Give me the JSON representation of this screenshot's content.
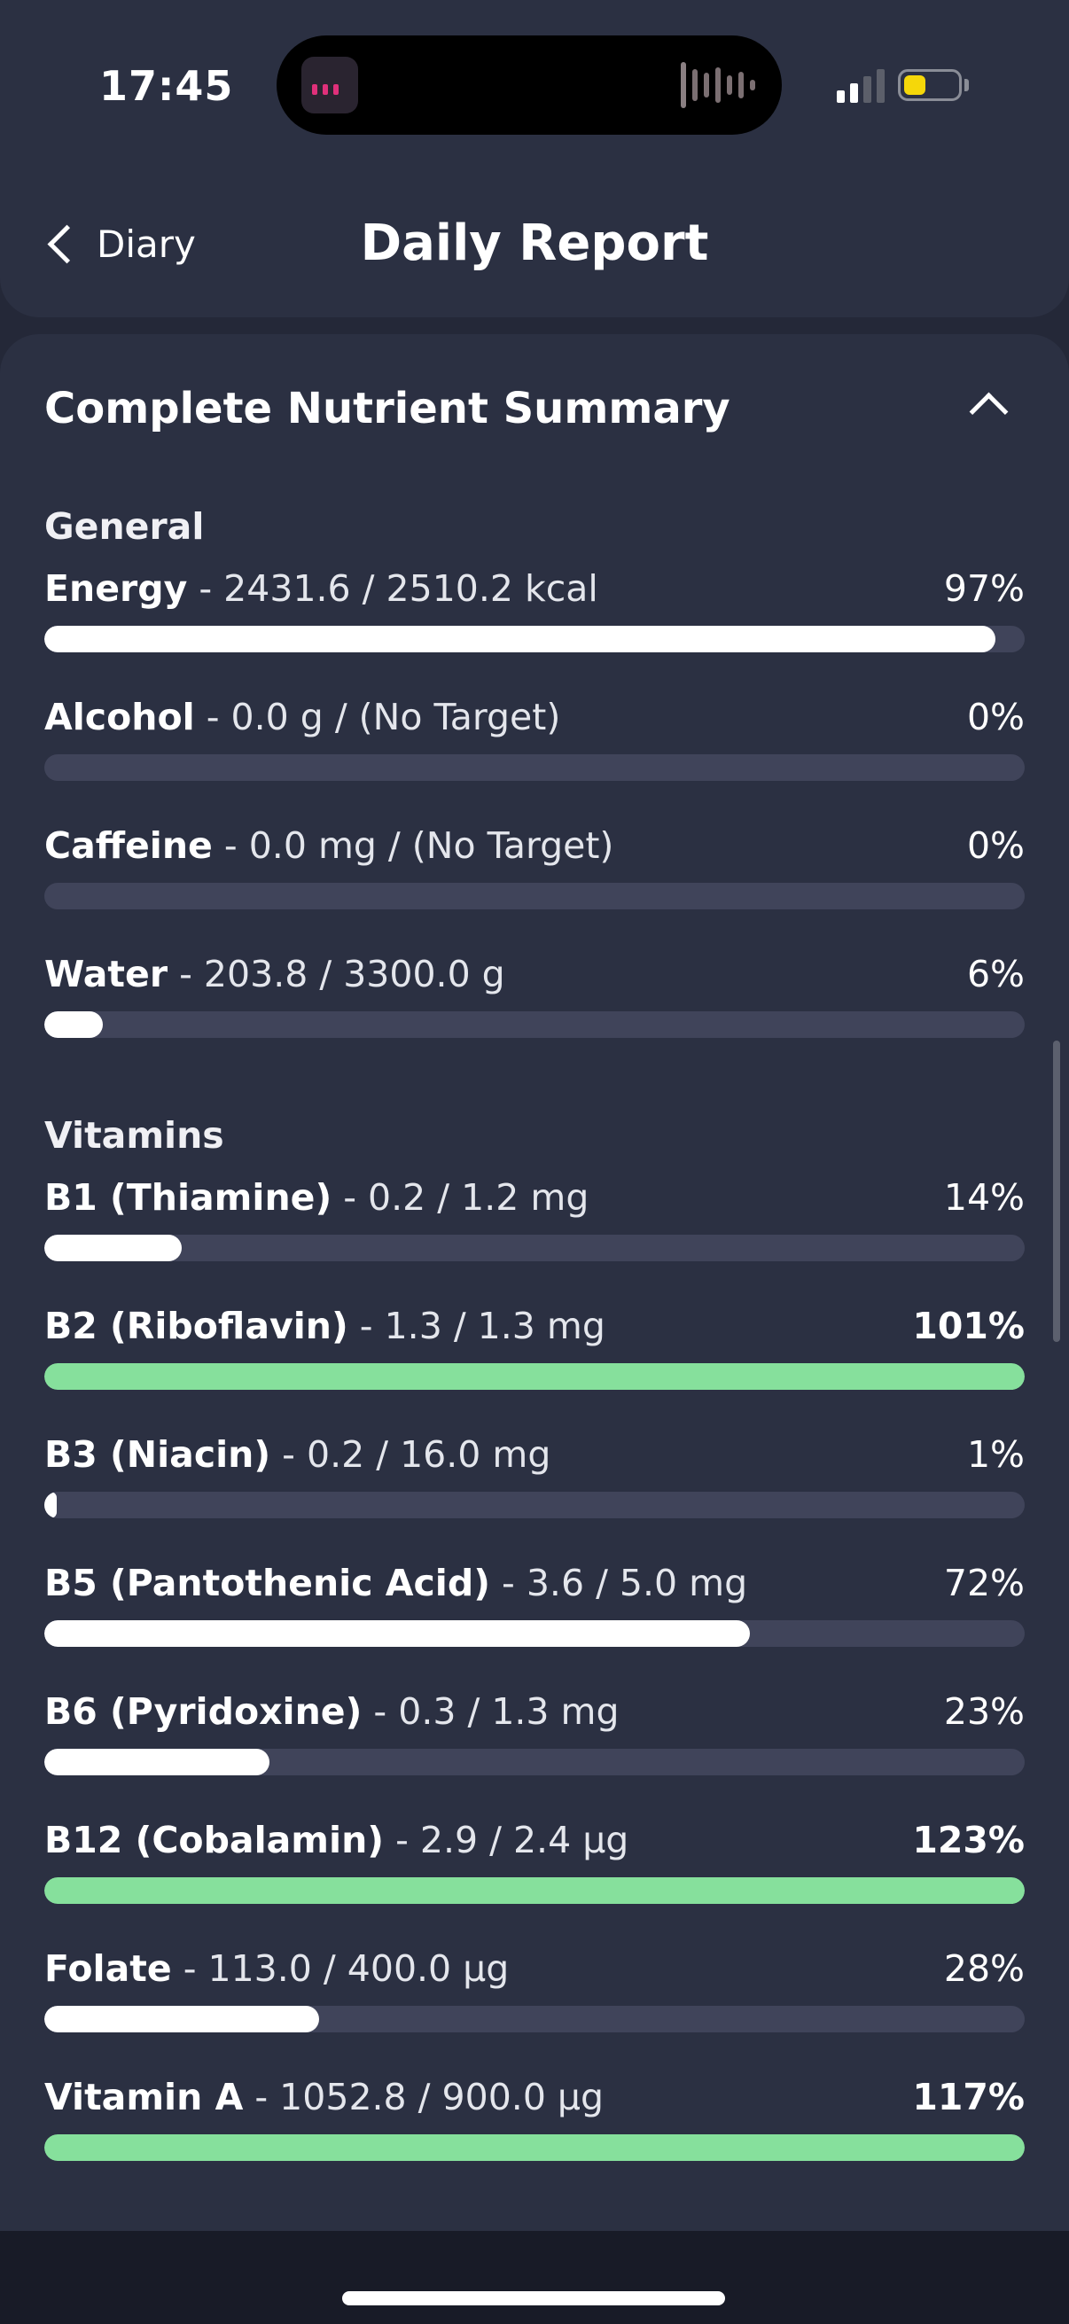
{
  "status_bar": {
    "time": "17:45"
  },
  "header": {
    "back_label": "Diary",
    "title": "Daily Report"
  },
  "card": {
    "title": "Complete Nutrient Summary"
  },
  "sections": [
    {
      "title": "General",
      "items": [
        {
          "name": "Energy",
          "detail": "- 2431.6 / 2510.2 kcal",
          "percent_label": "97%",
          "fraction": 0.97,
          "over": false
        },
        {
          "name": "Alcohol",
          "detail": "- 0.0 g / (No Target)",
          "percent_label": "0%",
          "fraction": 0.0,
          "over": false
        },
        {
          "name": "Caffeine",
          "detail": "- 0.0 mg / (No Target)",
          "percent_label": "0%",
          "fraction": 0.0,
          "over": false
        },
        {
          "name": "Water",
          "detail": "- 203.8 / 3300.0 g",
          "percent_label": "6%",
          "fraction": 0.06,
          "over": false
        }
      ]
    },
    {
      "title": "Vitamins",
      "items": [
        {
          "name": "B1 (Thiamine)",
          "detail": "- 0.2 / 1.2 mg",
          "percent_label": "14%",
          "fraction": 0.14,
          "over": false
        },
        {
          "name": "B2 (Riboflavin)",
          "detail": "- 1.3 / 1.3 mg",
          "percent_label": "101%",
          "fraction": 1.0,
          "over": true
        },
        {
          "name": "B3 (Niacin)",
          "detail": "- 0.2 / 16.0 mg",
          "percent_label": "1%",
          "fraction": 0.01,
          "over": false
        },
        {
          "name": "B5 (Pantothenic Acid)",
          "detail": "- 3.6 / 5.0 mg",
          "percent_label": "72%",
          "fraction": 0.72,
          "over": false
        },
        {
          "name": "B6 (Pyridoxine)",
          "detail": "- 0.3 / 1.3 mg",
          "percent_label": "23%",
          "fraction": 0.23,
          "over": false
        },
        {
          "name": "B12 (Cobalamin)",
          "detail": "- 2.9 / 2.4 µg",
          "percent_label": "123%",
          "fraction": 1.0,
          "over": true
        },
        {
          "name": "Folate",
          "detail": "- 113.0 / 400.0 µg",
          "percent_label": "28%",
          "fraction": 0.28,
          "over": false
        },
        {
          "name": "Vitamin A",
          "detail": "- 1052.8 / 900.0 µg",
          "percent_label": "117%",
          "fraction": 1.0,
          "over": true
        }
      ]
    }
  ],
  "colors": {
    "background": "#242838",
    "card": "#2b3042",
    "bar_track": "#40445a",
    "bar_fill": "#ffffff",
    "bar_over": "#86e09c"
  }
}
